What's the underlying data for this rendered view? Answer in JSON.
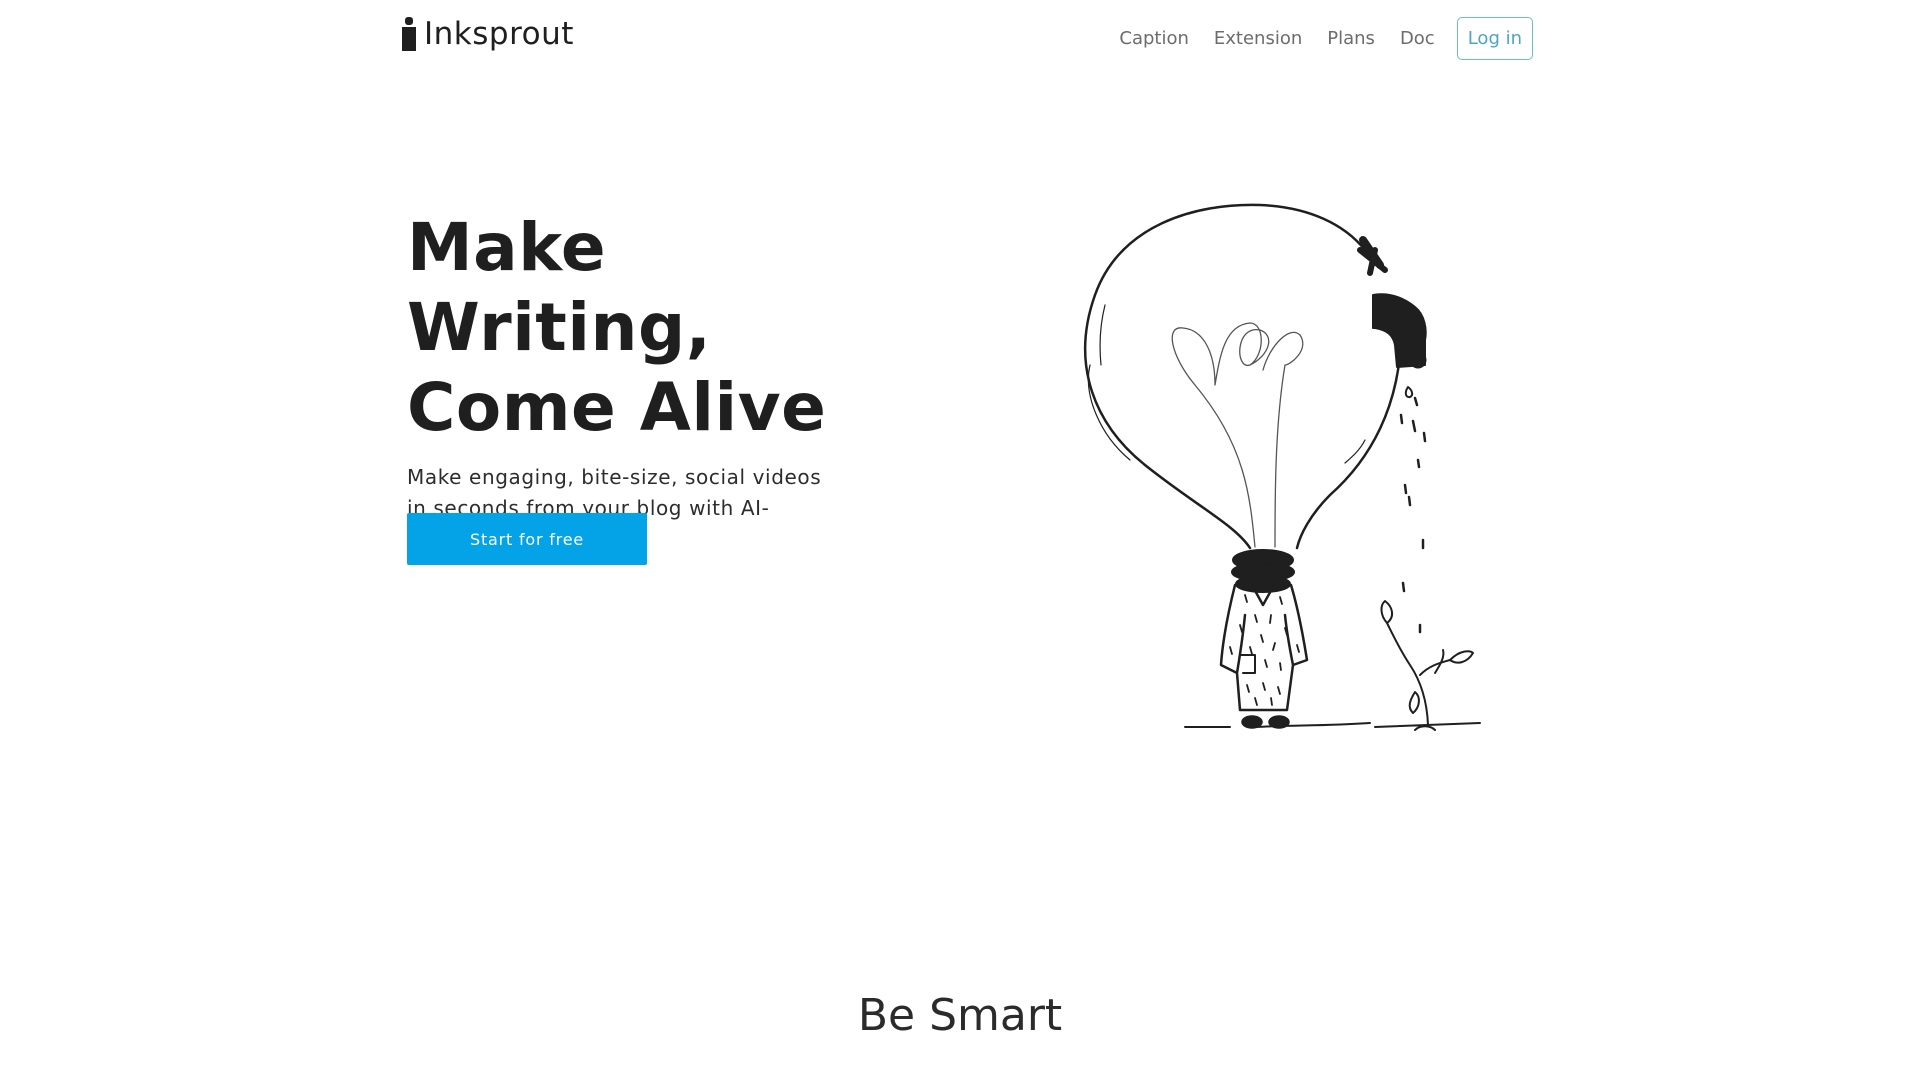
{
  "brand": {
    "name": "Inksprout",
    "logo_icon": "ink-bottle-icon"
  },
  "nav": {
    "links": [
      {
        "label": "Caption"
      },
      {
        "label": "Extension"
      },
      {
        "label": "Plans"
      },
      {
        "label": "Doc"
      }
    ],
    "login_label": "Log in"
  },
  "hero": {
    "title_line1": "Make Writing,",
    "title_line2": "Come Alive",
    "subtitle": "Make engaging, bite-size, social videos in seconds from your blog with AI-powered captions.",
    "cta_label": "Start for free",
    "illustration": "lightbulb-faucet-sprout-illustration"
  },
  "section": {
    "title": "Be Smart"
  },
  "colors": {
    "accent": "#04a3e8",
    "login_text": "#4aa7c3",
    "login_border": "#6bbcd3",
    "nav_text": "#6c6c6c",
    "heading": "#1f1f1f"
  }
}
